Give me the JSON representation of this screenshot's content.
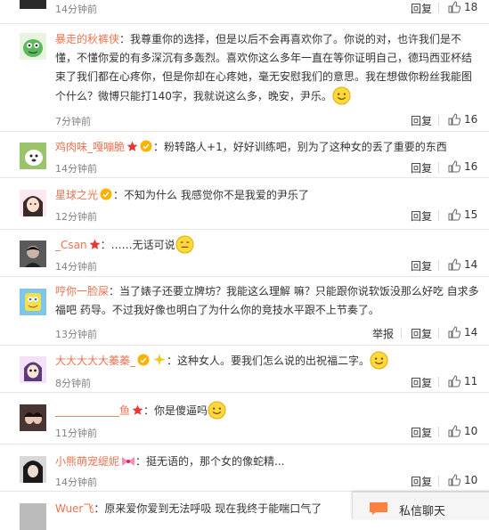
{
  "comments": [
    {
      "user": "",
      "text": "",
      "time": "14分钟前",
      "reply": "回复",
      "likes": "18"
    },
    {
      "user": "暴走的秋裤侠",
      "text": "：我尊重你的选择，但是以后不会再喜欢你了。你说的对，也许我们是不懂，不懂你爱的有多深沉有多轰烈。喜欢你这么多年一直在等你证明自己，德玛西亚杯结束了我们都在心疼你，但是你却在心疼她，毫无安慰我们的意思。我在想做你粉丝我能图个什么？微博只能打140字，我就说这么多，晚安，尹乐。",
      "time": "7分钟前",
      "reply": "回复",
      "likes": "16"
    },
    {
      "user": "鸡肉味_嘎嘣脆",
      "text": "：粉转路人+1，好好训练吧，别为了这种女的丢了重要的东西",
      "time": "14分钟前",
      "reply": "回复",
      "likes": "16"
    },
    {
      "user": "星球之光",
      "text": "：不知为什么 我感觉你不是我爱的尹乐了",
      "time": "12分钟前",
      "reply": "回复",
      "likes": "15"
    },
    {
      "user": "_Csan",
      "text": "：……无话可说",
      "time": "14分钟前",
      "reply": "回复",
      "likes": "14"
    },
    {
      "user": "哼你一脸屎",
      "text": "：当了婊子还要立牌坊？我能这么理解 嘛？只能跟你说软饭没那么好吃 自求多福吧 药导。不过我好像也明白了为什么你的竞技水平跟不上节奏了。",
      "time": "13分钟前",
      "report": "举报",
      "reply": "回复",
      "likes": "14"
    },
    {
      "user": "大大大大大蓁蓁_",
      "text": "：这种女人。要我们怎么说的出祝福二字。",
      "time": "8分钟前",
      "reply": "回复",
      "likes": "11"
    },
    {
      "user": "____________鱼",
      "text": "：你是傻逼吗",
      "time": "11分钟前",
      "reply": "回复",
      "likes": "10"
    },
    {
      "user": "小熊萌宠缇妮",
      "text": "：挺无语的，那个女的像蛇精...",
      "time": "14分钟前",
      "reply": "回复",
      "likes": "10"
    },
    {
      "user": "Wuer飞",
      "text": "：原来爱你爱到无法呼吸 现在我终于能喘口气了",
      "time": "",
      "reply": "",
      "likes": ""
    }
  ],
  "chat": {
    "label": "私信聊天"
  },
  "colors": {
    "username": "#eb7350",
    "time": "#808080"
  }
}
